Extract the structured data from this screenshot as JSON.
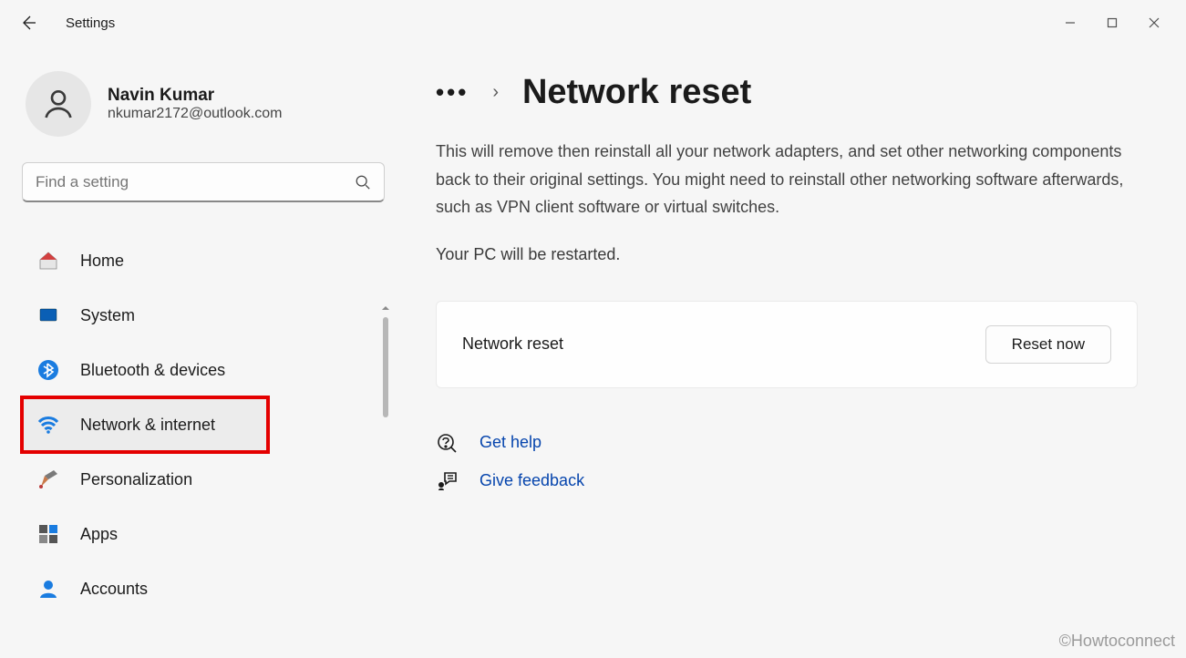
{
  "app": {
    "title": "Settings"
  },
  "window_controls": {
    "minimize": "—",
    "maximize": "▢",
    "close": "✕"
  },
  "profile": {
    "name": "Navin Kumar",
    "email": "nkumar2172@outlook.com"
  },
  "search": {
    "placeholder": "Find a setting"
  },
  "sidebar": {
    "items": [
      {
        "icon": "home-icon",
        "label": "Home"
      },
      {
        "icon": "system-icon",
        "label": "System"
      },
      {
        "icon": "bluetooth-icon",
        "label": "Bluetooth & devices"
      },
      {
        "icon": "wifi-icon",
        "label": "Network & internet"
      },
      {
        "icon": "personalization-icon",
        "label": "Personalization"
      },
      {
        "icon": "apps-icon",
        "label": "Apps"
      },
      {
        "icon": "accounts-icon",
        "label": "Accounts"
      }
    ],
    "active_index": 3
  },
  "breadcrumb": {
    "overflow": "•••",
    "chevron": "›"
  },
  "page": {
    "title": "Network reset",
    "description": "This will remove then reinstall all your network adapters, and set other networking components back to their original settings. You might need to reinstall other networking software afterwards, such as VPN client software or virtual switches.",
    "restart_note": "Your PC will be restarted."
  },
  "card": {
    "label": "Network reset",
    "button": "Reset now"
  },
  "links": {
    "help": "Get help",
    "feedback": "Give feedback"
  },
  "watermark": "©Howtoconnect"
}
